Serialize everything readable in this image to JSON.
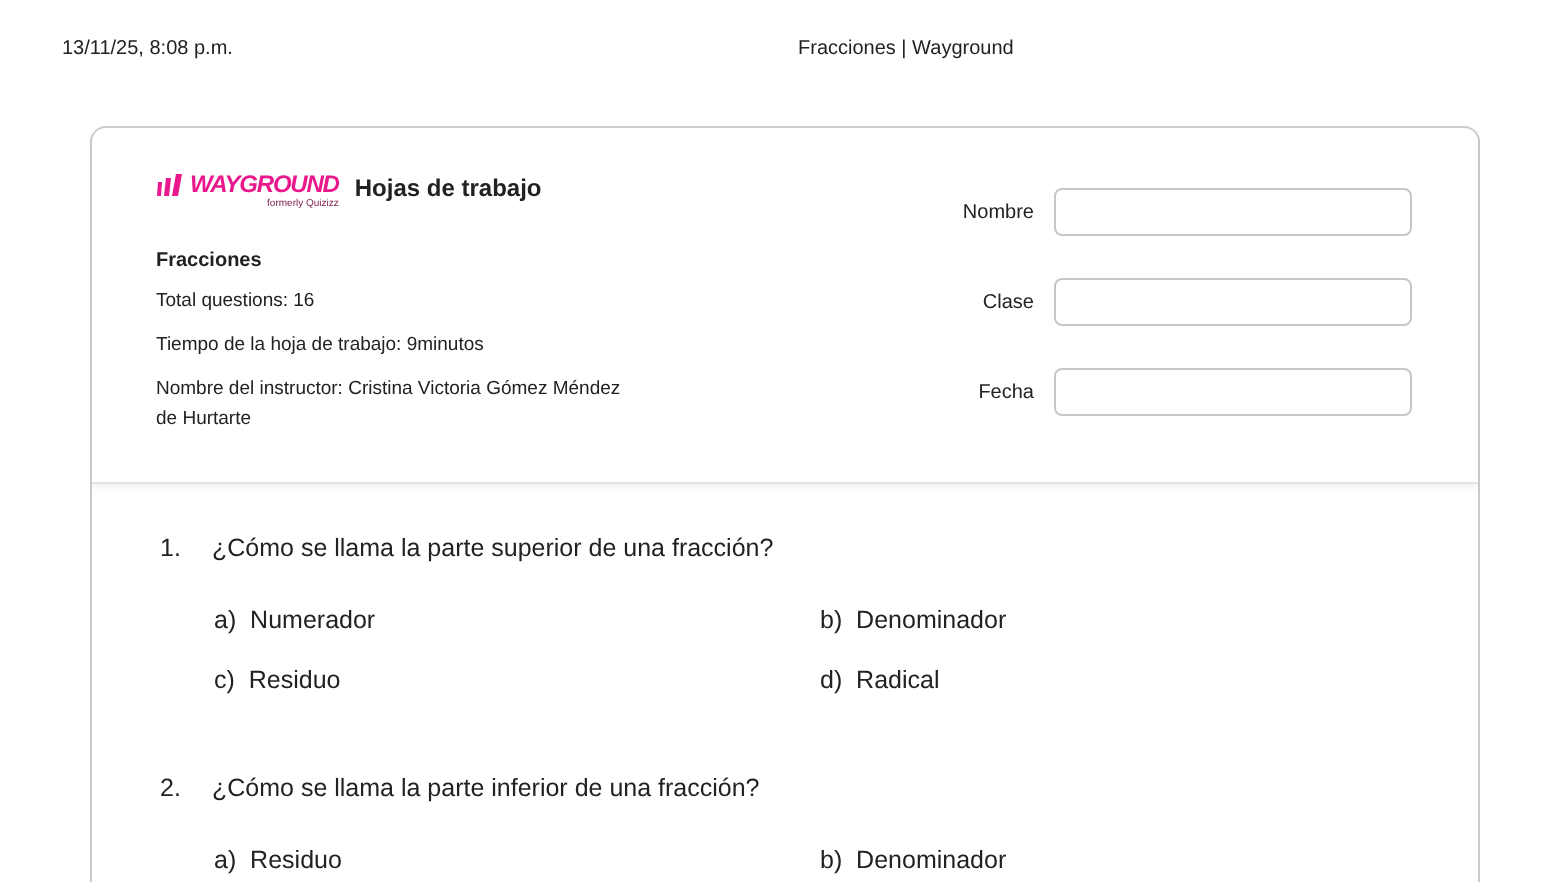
{
  "print_header": {
    "date": "13/11/25, 8:08 p.m.",
    "title": "Fracciones | Wayground"
  },
  "logo": {
    "name": "WAYGROUND",
    "tagline": "formerly Quizizz"
  },
  "heading": "Hojas de trabajo",
  "info": {
    "title": "Fracciones",
    "lines": [
      "Total questions: 16",
      "Tiempo de la hoja de trabajo: 9minutos",
      "Nombre del instructor: Cristina Victoria Gómez Méndez de Hurtarte"
    ]
  },
  "fields": [
    {
      "label": "Nombre"
    },
    {
      "label": "Clase"
    },
    {
      "label": "Fecha"
    }
  ],
  "questions": [
    {
      "number": "1.",
      "text": "¿Cómo se llama la parte superior de una fracción?",
      "options": [
        {
          "letter": "a)",
          "text": "Numerador"
        },
        {
          "letter": "b)",
          "text": "Denominador"
        },
        {
          "letter": "c)",
          "text": "Residuo"
        },
        {
          "letter": "d)",
          "text": "Radical"
        }
      ]
    },
    {
      "number": "2.",
      "text": "¿Cómo se llama la parte inferior de una fracción?",
      "options": [
        {
          "letter": "a)",
          "text": "Residuo"
        },
        {
          "letter": "b)",
          "text": "Denominador"
        }
      ]
    }
  ]
}
